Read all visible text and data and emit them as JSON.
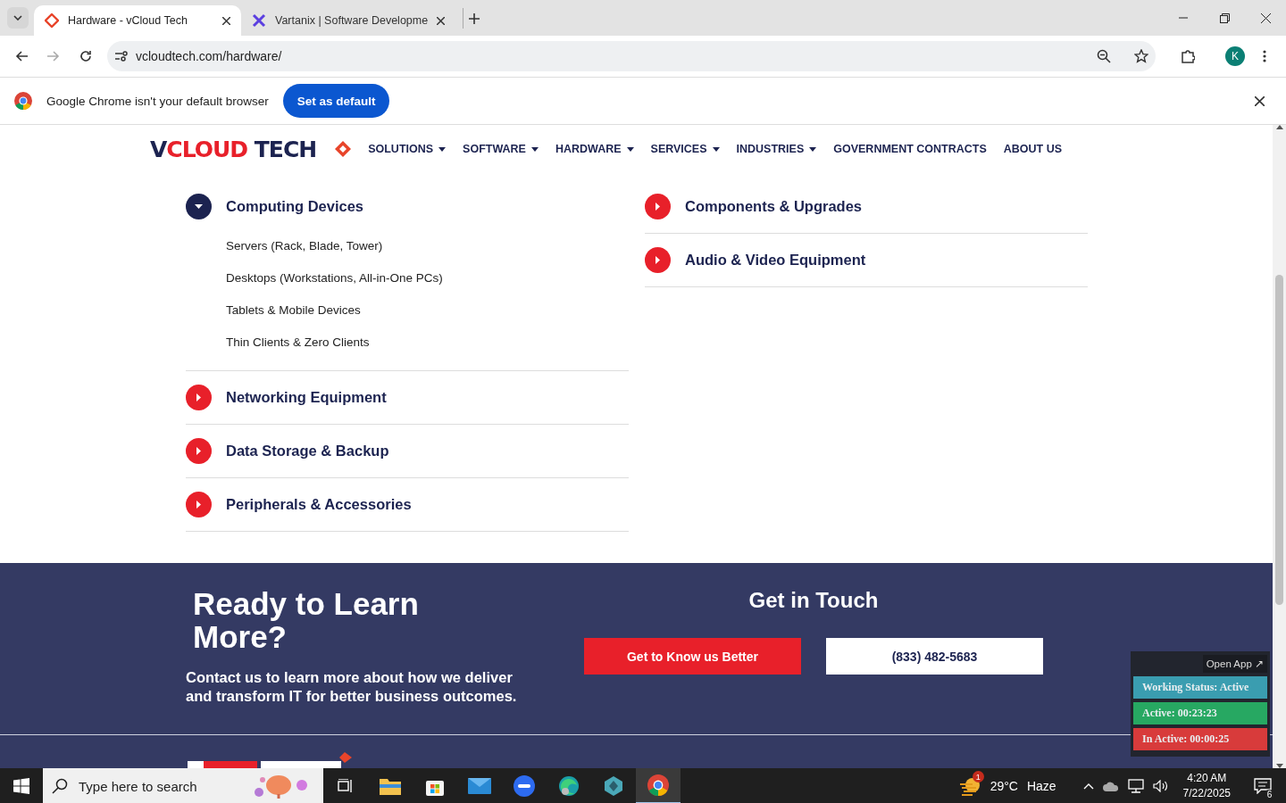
{
  "browser": {
    "tabs": [
      {
        "title": "Hardware - vCloud Tech",
        "selected": true
      },
      {
        "title": "Vartanix | Software Developme",
        "selected": false
      }
    ],
    "url": "vcloudtech.com/hardware/",
    "profile": "K"
  },
  "infobar": {
    "message": "Google Chrome isn't your default browser",
    "button": "Set as default"
  },
  "site": {
    "logo": [
      {
        "text": "V",
        "color": "#1c2350"
      },
      {
        "text": "CLOUD",
        "color": "#e8202a"
      },
      {
        "text": " TECH",
        "color": "#1c2350"
      }
    ],
    "nav": [
      {
        "label": "SOLUTIONS",
        "dropdown": true
      },
      {
        "label": "SOFTWARE",
        "dropdown": true
      },
      {
        "label": "HARDWARE",
        "dropdown": true
      },
      {
        "label": "SERVICES",
        "dropdown": true
      },
      {
        "label": "INDUSTRIES",
        "dropdown": true
      },
      {
        "label": "GOVERNMENT CONTRACTS",
        "dropdown": false
      },
      {
        "label": "ABOUT US",
        "dropdown": false
      }
    ],
    "left_column": [
      {
        "title": "Computing Devices",
        "expanded": true,
        "children": [
          "Servers (Rack, Blade, Tower)",
          "Desktops (Workstations, All-in-One PCs)",
          "Tablets & Mobile Devices",
          "Thin Clients & Zero Clients"
        ]
      },
      {
        "title": "Networking Equipment",
        "expanded": false
      },
      {
        "title": "Data Storage & Backup",
        "expanded": false
      },
      {
        "title": "Peripherals & Accessories",
        "expanded": false
      }
    ],
    "right_column": [
      {
        "title": "Components & Upgrades",
        "expanded": false
      },
      {
        "title": "Audio & Video Equipment",
        "expanded": false
      }
    ],
    "cta": {
      "heading": "Ready to Learn More?",
      "text": "Contact us to learn more about how we deliver and transform IT for better business outcomes.",
      "contact_heading": "Get in Touch",
      "primary_button": "Get to Know us Better",
      "phone_button": "(833) 482-5683"
    }
  },
  "tracker": {
    "open_app": "Open App ↗",
    "rows": [
      {
        "text": "Working Status: Active",
        "color": "#3a9db0"
      },
      {
        "text": "Active: 00:23:23",
        "color": "#27a862"
      },
      {
        "text": "In Active: 00:00:25",
        "color": "#d83b3b"
      }
    ]
  },
  "taskbar": {
    "search_placeholder": "Type here to search",
    "weather_badge": "1",
    "temperature": "29°C",
    "weather": "Haze",
    "time": "4:20 AM",
    "date": "7/22/2025",
    "notifications": "6"
  }
}
